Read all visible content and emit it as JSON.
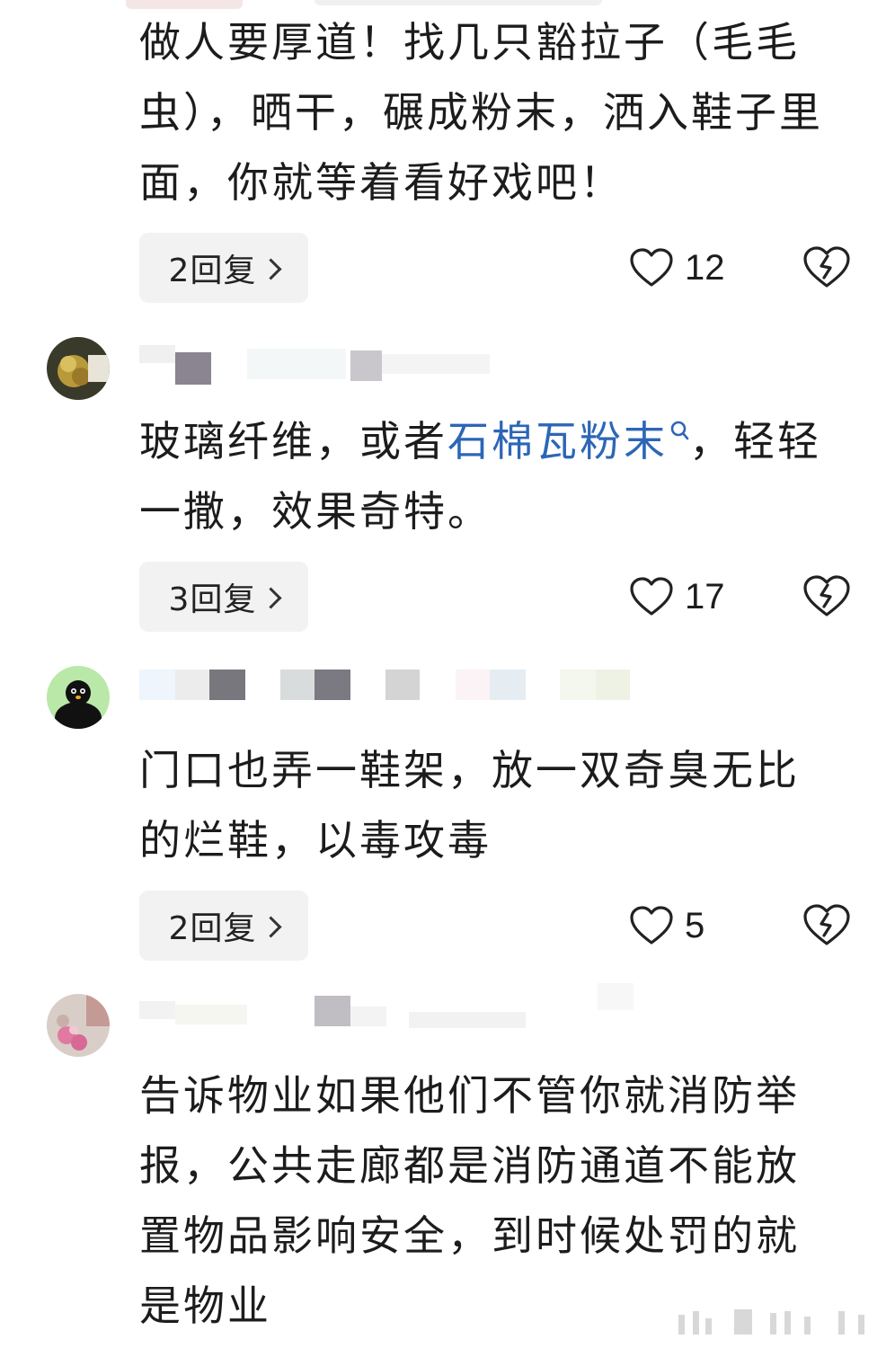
{
  "comments": [
    {
      "text": "做人要厚道！找几只豁拉子（毛毛虫），晒干，碾成粉末，洒入鞋子里面，你就等着看好戏吧！",
      "reply_label": "2回复",
      "likes": "12"
    },
    {
      "text_before_link": "玻璃纤维，或者",
      "link_text": "石棉瓦粉末",
      "text_after_link": "，轻轻一撒，效果奇特。",
      "reply_label": "3回复",
      "likes": "17"
    },
    {
      "text": "门口也弄一鞋架，放一双奇臭无比的烂鞋，以毒攻毒",
      "reply_label": "2回复",
      "likes": "5"
    },
    {
      "text": "告诉物业如果他们不管你就消防举报，公共走廊都是消防通道不能放置物品影响安全，到时候处罚的就是物业"
    }
  ],
  "icons": {
    "like": "heart-outline-icon",
    "dislike": "broken-heart-icon",
    "reply_chevron": "chevron-right-icon",
    "search_link": "search-icon"
  },
  "colors": {
    "link": "#2c66b6",
    "reply_bg": "#f2f2f2",
    "text": "#1c1c1c"
  }
}
